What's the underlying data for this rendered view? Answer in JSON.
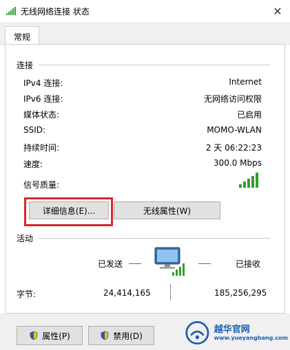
{
  "window": {
    "title": "无线网络连接 状态",
    "close_glyph": "✕"
  },
  "tabs": [
    {
      "label": "常规"
    }
  ],
  "connection": {
    "section_title": "连接",
    "rows": [
      {
        "label": "IPv4 连接:",
        "value": "Internet"
      },
      {
        "label": "IPv6 连接:",
        "value": "无网络访问权限"
      },
      {
        "label": "媒体状态:",
        "value": "已启用"
      },
      {
        "label": "SSID:",
        "value": "MOMO-WLAN"
      },
      {
        "label": "持续时间:",
        "value": "2 天 06:22:23"
      },
      {
        "label": "速度:",
        "value": "300.0 Mbps"
      }
    ],
    "signal_label": "信号质量:",
    "signal_bars": 5,
    "details_button": "详细信息(E)...",
    "wireless_props_button": "无线属性(W)"
  },
  "activity": {
    "section_title": "活动",
    "sent_label": "已发送",
    "received_label": "已接收",
    "bytes_label": "字节:",
    "bytes_sent": "24,414,165",
    "bytes_received": "185,256,295"
  },
  "bottom_buttons": {
    "properties": "属性(P)",
    "disable": "禁用(D)"
  },
  "watermark": {
    "brand": "越华官网",
    "url": "www.yueyangbang.com"
  },
  "colors": {
    "highlight": "#d9262c",
    "signal_green": "#2e9e2e"
  }
}
